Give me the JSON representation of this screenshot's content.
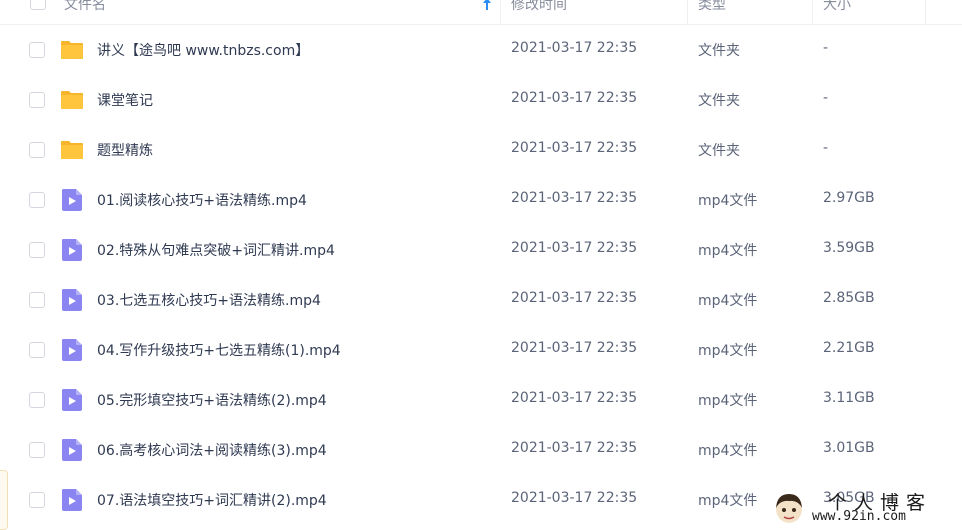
{
  "header": {
    "name_label": "文件名",
    "modified_label": "修改时间",
    "type_label": "类型",
    "size_label": "大小"
  },
  "files": [
    {
      "icon": "folder-icon",
      "name": "讲义【途鸟吧 www.tnbzs.com】",
      "date": "2021-03-17 22:35",
      "type": "文件夹",
      "size": "-"
    },
    {
      "icon": "folder-icon",
      "name": "课堂笔记",
      "date": "2021-03-17 22:35",
      "type": "文件夹",
      "size": "-"
    },
    {
      "icon": "folder-icon",
      "name": "题型精炼",
      "date": "2021-03-17 22:35",
      "type": "文件夹",
      "size": "-"
    },
    {
      "icon": "video-file-icon",
      "name": "01.阅读核心技巧+语法精练.mp4",
      "date": "2021-03-17 22:35",
      "type": "mp4文件",
      "size": "2.97GB"
    },
    {
      "icon": "video-file-icon",
      "name": "02.特殊从句难点突破+词汇精讲.mp4",
      "date": "2021-03-17 22:35",
      "type": "mp4文件",
      "size": "3.59GB"
    },
    {
      "icon": "video-file-icon",
      "name": "03.七选五核心技巧+语法精练.mp4",
      "date": "2021-03-17 22:35",
      "type": "mp4文件",
      "size": "2.85GB"
    },
    {
      "icon": "video-file-icon",
      "name": "04.写作升级技巧+七选五精练(1).mp4",
      "date": "2021-03-17 22:35",
      "type": "mp4文件",
      "size": "2.21GB"
    },
    {
      "icon": "video-file-icon",
      "name": "05.完形填空技巧+语法精练(2).mp4",
      "date": "2021-03-17 22:35",
      "type": "mp4文件",
      "size": "3.11GB"
    },
    {
      "icon": "video-file-icon",
      "name": "06.高考核心词法+阅读精练(3).mp4",
      "date": "2021-03-17 22:35",
      "type": "mp4文件",
      "size": "3.01GB"
    },
    {
      "icon": "video-file-icon",
      "name": "07.语法填空技巧+词汇精讲(2).mp4",
      "date": "2021-03-17 22:35",
      "type": "mp4文件",
      "size": "3.05GB"
    }
  ],
  "watermark": {
    "title": "个人博客",
    "url": "www.92in.com"
  },
  "colors": {
    "folder": "#ffc53d",
    "folder_tab": "#f7b52c",
    "video": "#8a85f0",
    "sort_arrow": "#2a8cf5"
  }
}
